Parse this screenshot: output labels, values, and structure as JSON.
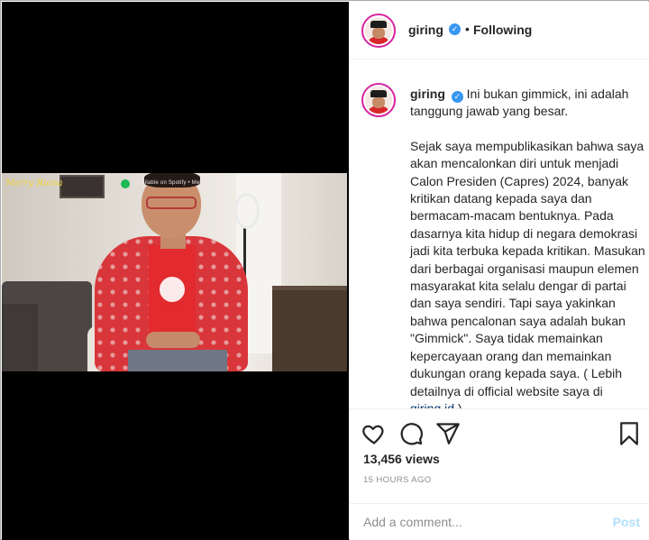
{
  "header": {
    "username": "giring",
    "separator": "•",
    "follow_status": "Following"
  },
  "video": {
    "watermark_left": "Merry Riana",
    "watermark_center": "Available on Spotify • Merry Riana"
  },
  "caption": {
    "username": "giring",
    "paragraph_1": "Ini bukan gimmick, ini adalah tanggung jawab yang besar.",
    "paragraph_2": "Sejak saya mempublikasikan bahwa saya akan mencalonkan diri untuk menjadi Calon Presiden (Capres) 2024, banyak kritikan datang kepada saya dan bermacam-macam bentuknya. Pada dasarnya kita hidup di negara demokrasi jadi kita terbuka kepada kritikan. Masukan dari berbagai organisasi maupun elemen masyarakat kita selalu dengar di partai dan saya sendiri. Tapi saya yakinkan bahwa pencalonan saya adalah bukan \"Gimmick\". Saya tidak memainkan kepercayaan orang dan memainkan dukungan orang kepada saya. ( Lebih detailnya di official website saya di",
    "link_text": "giring.id",
    "paragraph_2_end": ")"
  },
  "stats": {
    "views": "13,456 views",
    "time_ago": "15 HOURS AGO"
  },
  "comment": {
    "placeholder": "Add a comment...",
    "post_label": "Post"
  },
  "icons": {
    "like": "heart-icon",
    "comment": "comment-icon",
    "share": "share-icon",
    "save": "bookmark-icon",
    "verified": "verified-badge-icon"
  },
  "colors": {
    "verified_blue": "#3897f0",
    "post_disabled": "#b2dffc",
    "secondary_text": "#8e8e8e",
    "link": "#00376b",
    "avatar_ring": "#d6249f"
  }
}
